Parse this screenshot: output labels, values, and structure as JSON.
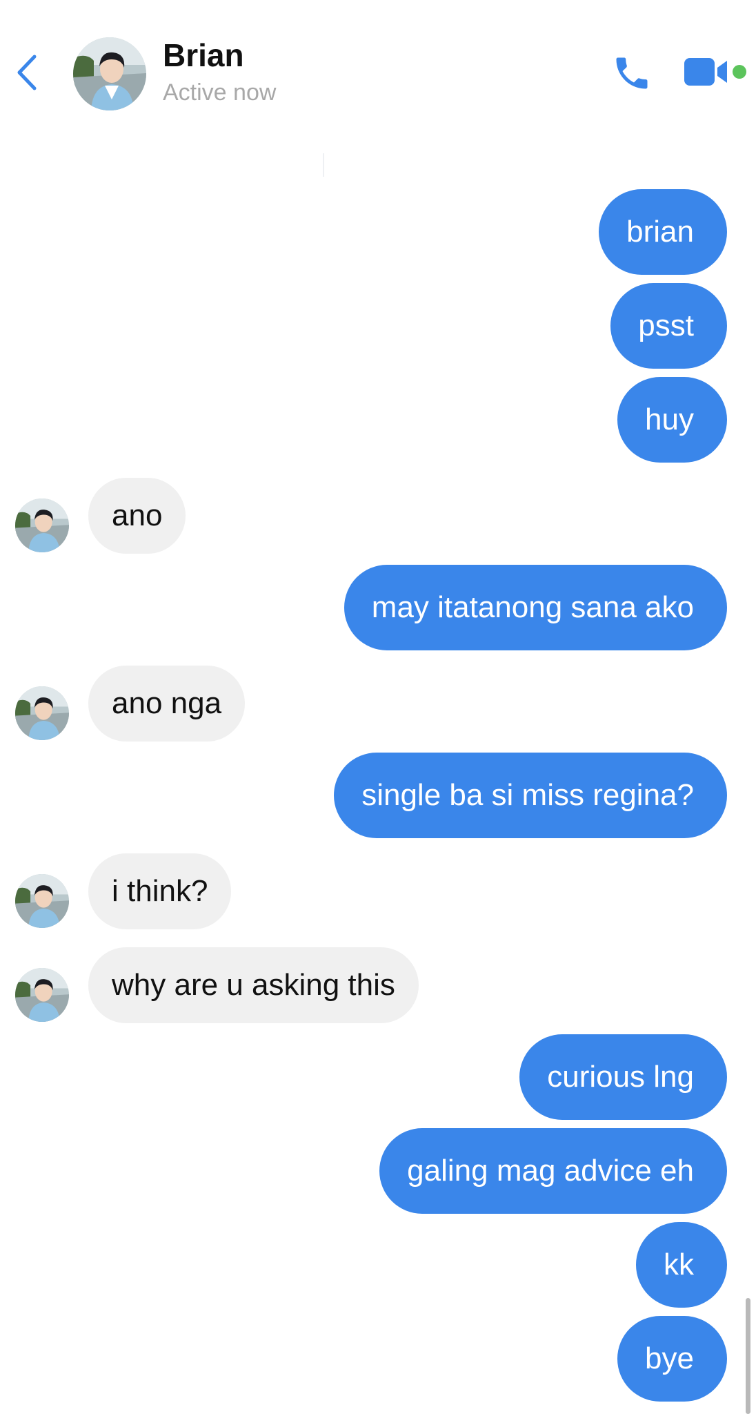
{
  "header": {
    "contact_name": "Brian",
    "status": "Active now",
    "back_icon": "chevron-left-icon",
    "call_icon": "phone-icon",
    "video_icon": "video-camera-icon",
    "accent_color": "#3a86ea",
    "online_color": "#5cc45c"
  },
  "messages": [
    {
      "direction": "outgoing",
      "text": "brian"
    },
    {
      "direction": "outgoing",
      "text": "psst"
    },
    {
      "direction": "outgoing",
      "text": "huy"
    },
    {
      "direction": "incoming",
      "text": "ano"
    },
    {
      "direction": "outgoing",
      "text": "may itatanong sana ako"
    },
    {
      "direction": "incoming",
      "text": "ano nga"
    },
    {
      "direction": "outgoing",
      "text": "single ba si miss regina?"
    },
    {
      "direction": "incoming",
      "text": "i think?"
    },
    {
      "direction": "incoming",
      "text": "why are u asking this"
    },
    {
      "direction": "outgoing",
      "text": "curious lng"
    },
    {
      "direction": "outgoing",
      "text": "galing mag advice eh"
    },
    {
      "direction": "outgoing",
      "text": "kk"
    },
    {
      "direction": "outgoing",
      "text": "bye"
    }
  ],
  "colors": {
    "outgoing_bubble": "#3a86ea",
    "incoming_bubble": "#f0f0f0"
  }
}
